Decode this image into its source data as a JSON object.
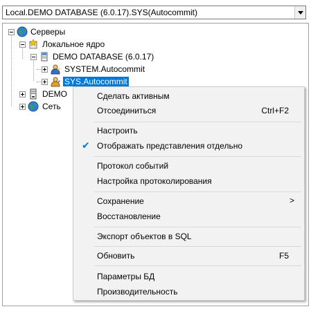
{
  "combo": {
    "value": "Local.DEMO DATABASE (6.0.17).SYS(Autocommit)"
  },
  "tree": {
    "root": "Серверы",
    "local": "Локальное ядро",
    "database": "DEMO DATABASE (6.0.17)",
    "conn1": "SYSTEM.Autocommit",
    "conn2": "SYS.Autocommit",
    "demo": "DEMO",
    "network": "Сеть"
  },
  "menu": {
    "items": [
      {
        "label": "Сделать активным"
      },
      {
        "label": "Отсоединиться",
        "shortcut": "Ctrl+F2"
      },
      {
        "label": "Настроить"
      },
      {
        "label": "Отображать представления отдельно",
        "checked": true
      },
      {
        "label": "Протокол событий"
      },
      {
        "label": "Настройка протоколирования"
      },
      {
        "label": "Сохранение",
        "submenu": ">"
      },
      {
        "label": "Восстановление"
      },
      {
        "label": "Экспорт объектов в SQL"
      },
      {
        "label": "Обновить",
        "shortcut": "F5"
      },
      {
        "label": "Параметры БД"
      },
      {
        "label": "Производительность"
      }
    ]
  },
  "colors": {
    "selection": "#0078d7",
    "menu_bg": "#f2f2f2"
  }
}
